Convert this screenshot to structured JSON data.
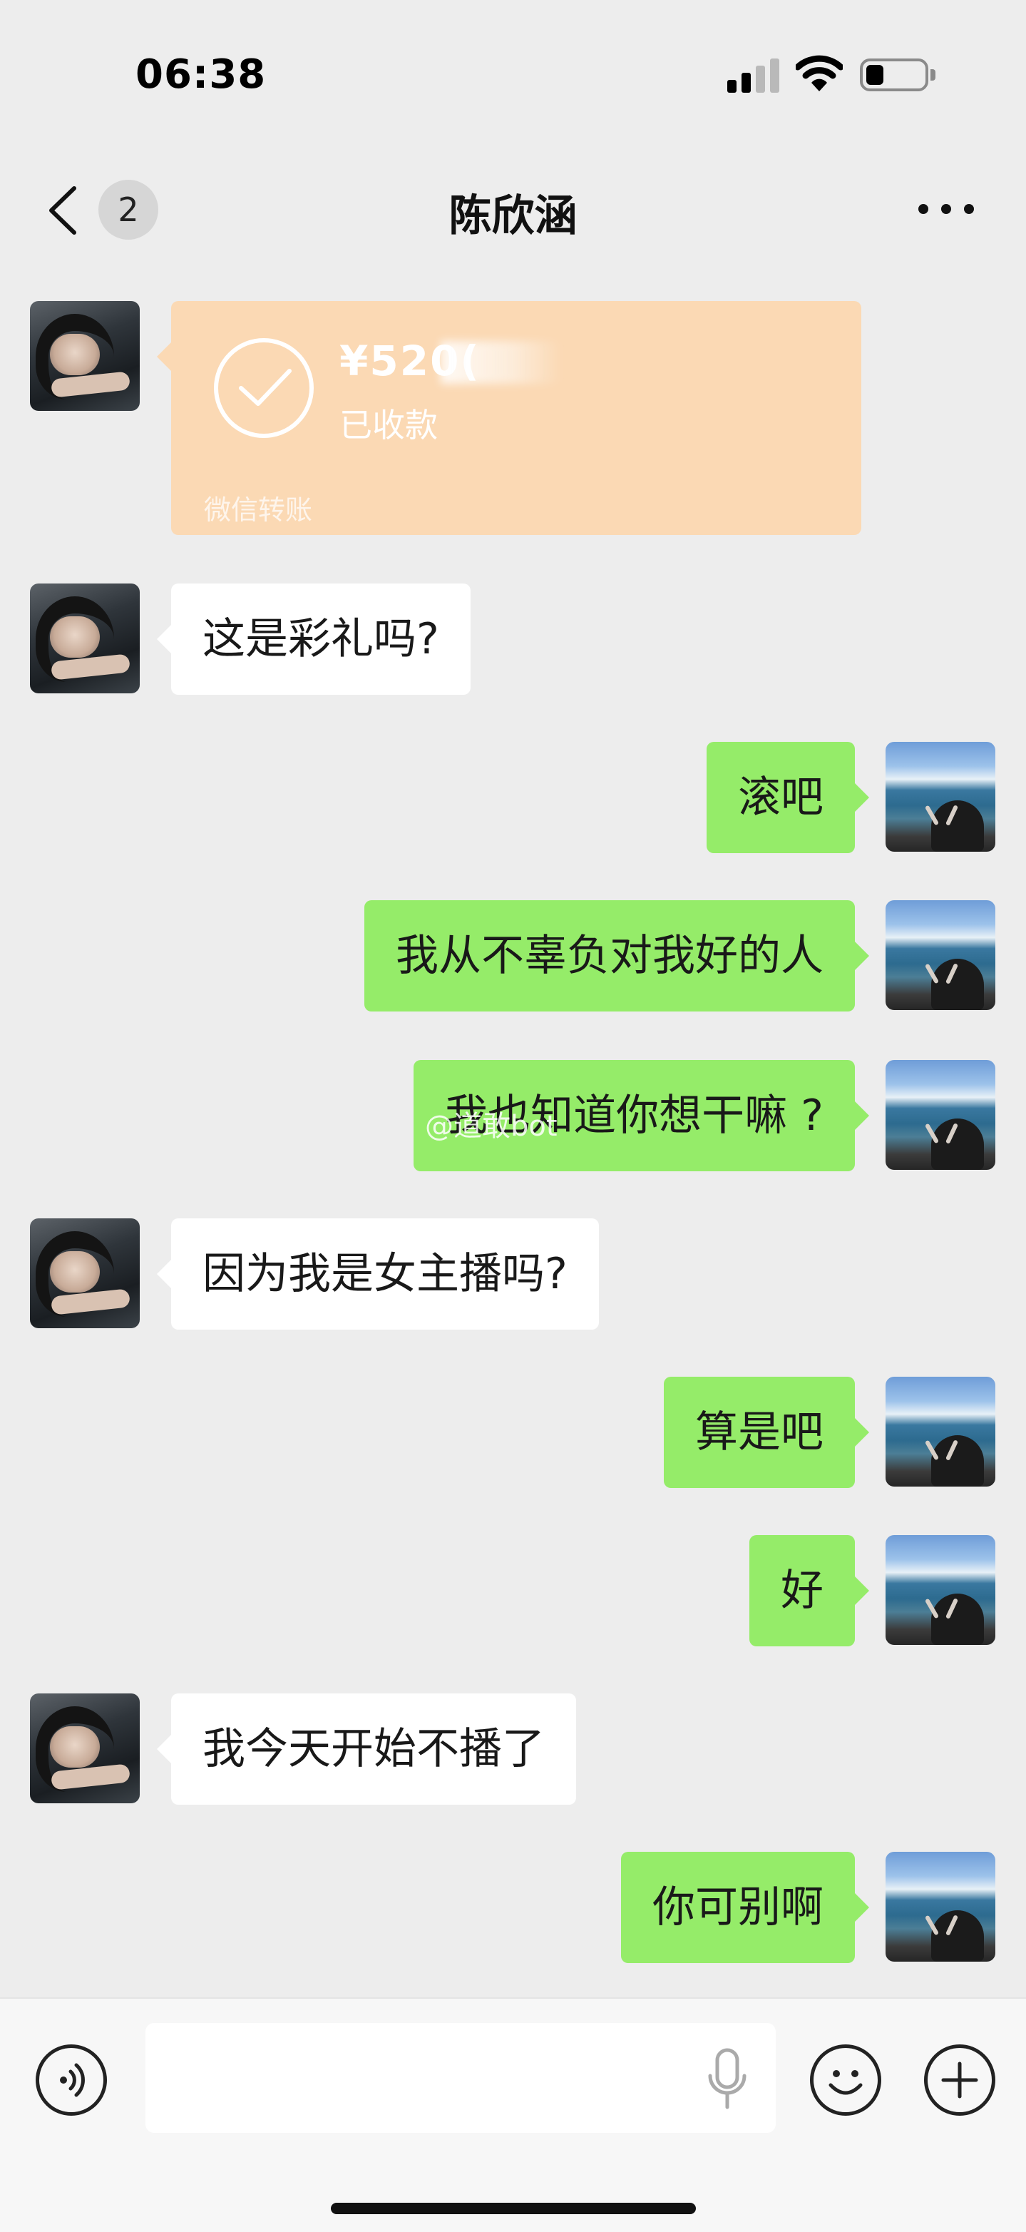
{
  "status_bar": {
    "time": "06:38",
    "battery_level": 0.25
  },
  "header": {
    "unread_count": "2",
    "title": "陈欣涵"
  },
  "transfer": {
    "amount_visible": "¥520(",
    "status": "已收款",
    "footer": "微信转账"
  },
  "messages": [
    {
      "side": "left",
      "text": "这是彩礼吗?"
    },
    {
      "side": "right",
      "text": "滚吧"
    },
    {
      "side": "right",
      "text": "我从不辜负对我好的人"
    },
    {
      "side": "right",
      "text": "我也知道你想干嘛 ?"
    },
    {
      "side": "left",
      "text": "因为我是女主播吗?"
    },
    {
      "side": "right",
      "text": "算是吧"
    },
    {
      "side": "right",
      "text": "好"
    },
    {
      "side": "left",
      "text": "我今天开始不播了"
    },
    {
      "side": "right",
      "text": "你可别啊"
    }
  ],
  "watermark": "@道敢bot",
  "input": {
    "value": ""
  },
  "colors": {
    "background": "#ededed",
    "sent_bubble": "#95ec69",
    "received_bubble": "#ffffff",
    "transfer_card": "#fbd9b4"
  }
}
